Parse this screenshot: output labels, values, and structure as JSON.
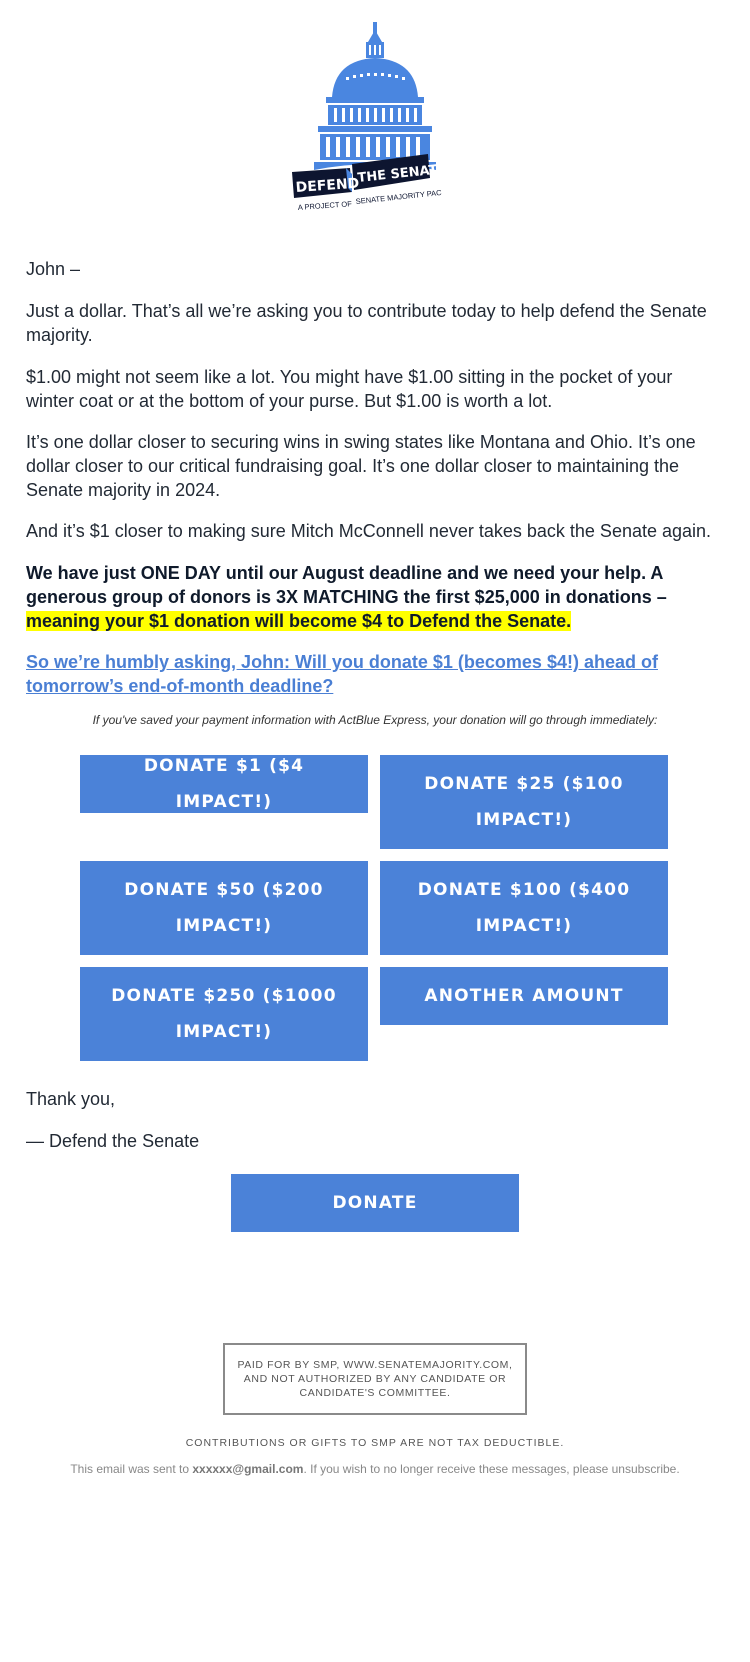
{
  "logo": {
    "line1_left": "DEFEND",
    "line1_right": "THE SENATE",
    "line2_left": "A PROJECT OF",
    "line2_right": "SENATE MAJORITY PAC",
    "colors": {
      "dome": "#4a86e0",
      "banner": "#0d1530"
    }
  },
  "email": {
    "greeting": "John –",
    "paragraphs": [
      "Just a dollar. That’s all we’re asking you to contribute today to help defend the Senate majority.",
      "$1.00 might not seem like a lot. You might have $1.00 sitting in the pocket of your winter coat or at the bottom of your purse. But $1.00 is worth a lot.",
      "It’s one dollar closer to securing wins in swing states like Montana and Ohio. It’s one dollar closer to our critical fundraising goal. It’s one dollar closer to maintaining the Senate majority in 2024.",
      "And it’s $1 closer to making sure Mitch McConnell never takes back the Senate again."
    ],
    "bold_paragraph": {
      "plain": "We have just ONE DAY until our August deadline and we need your help. A generous group of donors is 3X MATCHING the first $25,000 in donations – ",
      "highlighted": "meaning your $1 donation will become $4 to Defend the Senate."
    },
    "ask_link": "So we’re humbly asking, John: Will you donate $1 (becomes $4!) ahead of tomorrow’s end-of-month deadline?",
    "express_note": "If you've saved your payment information with ActBlue Express, your donation will go through immediately:",
    "donate_buttons": [
      "DONATE $1 ($4 IMPACT!)",
      "DONATE $25 ($100 IMPACT!)",
      "DONATE $50 ($200 IMPACT!)",
      "DONATE $100 ($400 IMPACT!)",
      "DONATE $250 ($1000 IMPACT!)",
      "ANOTHER AMOUNT"
    ],
    "thanks": "Thank you,",
    "signoff": "— Defend the Senate",
    "donate_main": "DONATE"
  },
  "footer": {
    "disclaimer": "PAID FOR BY SMP, WWW.SENATEMAJORITY.COM, AND NOT AUTHORIZED BY ANY CANDIDATE OR CANDIDATE'S COMMITTEE.",
    "tax_note": "CONTRIBUTIONS OR GIFTS TO SMP ARE NOT TAX DEDUCTIBLE.",
    "sent_prefix": "This email was sent to ",
    "sent_email": "xxxxxx@gmail.com",
    "sent_suffix": ". If you wish to no longer receive these messages, please unsubscribe."
  },
  "colors": {
    "button": "#4b82d8",
    "link": "#4a7fd4",
    "highlight": "#ffff00"
  }
}
